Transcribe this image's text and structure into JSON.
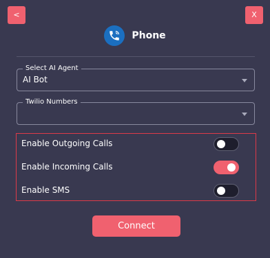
{
  "nav": {
    "back_label": "<",
    "close_label": "X"
  },
  "header": {
    "title": "Phone",
    "icon": "phone-icon"
  },
  "agent_select": {
    "label": "Select AI Agent",
    "value": "AI Bot",
    "icon": "chevron-down-icon"
  },
  "twilio_select": {
    "label": "Twilio Numbers",
    "value": "",
    "icon": "chevron-down-icon"
  },
  "toggles": {
    "outgoing": {
      "label": "Enable Outgoing Calls",
      "enabled": false
    },
    "incoming": {
      "label": "Enable Incoming Calls",
      "enabled": true
    },
    "sms": {
      "label": "Enable SMS",
      "enabled": false
    }
  },
  "connect_label": "Connect",
  "colors": {
    "background": "#393950",
    "accent": "#f0616f",
    "highlight_border": "#e03a48",
    "phone_icon_bg": "#1b6fc0"
  }
}
